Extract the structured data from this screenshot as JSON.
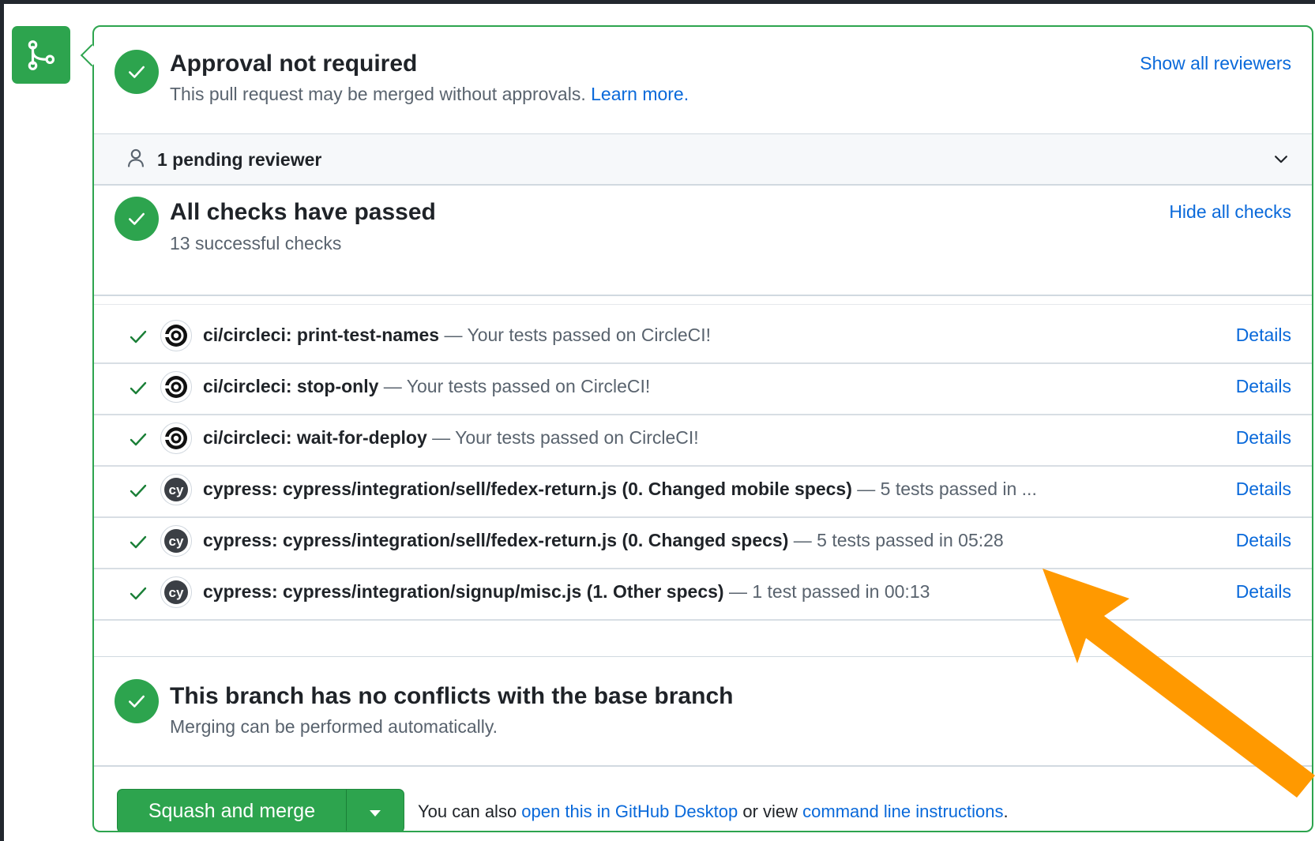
{
  "approval": {
    "title": "Approval not required",
    "subtitle": "This pull request may be merged without approvals.",
    "learn_more": "Learn more.",
    "show_reviewers": "Show all reviewers"
  },
  "pending": {
    "label": "1 pending reviewer"
  },
  "checks": {
    "title": "All checks have passed",
    "subtitle": "13 successful checks",
    "hide_link": "Hide all checks",
    "details_label": "Details",
    "items": [
      {
        "name": "ci/circleci: print-test-names",
        "desc": " — Your tests passed on CircleCI!",
        "provider": "circleci"
      },
      {
        "name": "ci/circleci: stop-only",
        "desc": " — Your tests passed on CircleCI!",
        "provider": "circleci"
      },
      {
        "name": "ci/circleci: wait-for-deploy",
        "desc": " — Your tests passed on CircleCI!",
        "provider": "circleci"
      },
      {
        "name": "cypress: cypress/integration/sell/fedex-return.js (0. Changed mobile specs)",
        "desc": " — 5 tests passed in ...",
        "provider": "cypress"
      },
      {
        "name": "cypress: cypress/integration/sell/fedex-return.js (0. Changed specs)",
        "desc": " — 5 tests passed in 05:28",
        "provider": "cypress"
      },
      {
        "name": "cypress: cypress/integration/signup/misc.js (1. Other specs)",
        "desc": " — 1 test passed in 00:13",
        "provider": "cypress"
      }
    ]
  },
  "conflicts": {
    "title": "This branch has no conflicts with the base branch",
    "subtitle": "Merging can be performed automatically."
  },
  "merge": {
    "button_label": "Squash and merge",
    "note_prefix": "You can also ",
    "desktop_link": "open this in GitHub Desktop",
    "note_middle": " or view ",
    "cli_link": "command line instructions",
    "note_suffix": "."
  },
  "colors": {
    "success": "#2da44e",
    "link": "#0969da",
    "annotation_arrow": "#ff9900"
  },
  "icons": {
    "merge_badge": "git-merge-icon",
    "status": "check-circle-icon",
    "pending": "person-icon",
    "expand": "chevron-down-icon",
    "check": "check-icon",
    "circleci": "circleci-logo-icon",
    "cypress": "cypress-logo-icon",
    "caret": "triangle-down-icon"
  }
}
